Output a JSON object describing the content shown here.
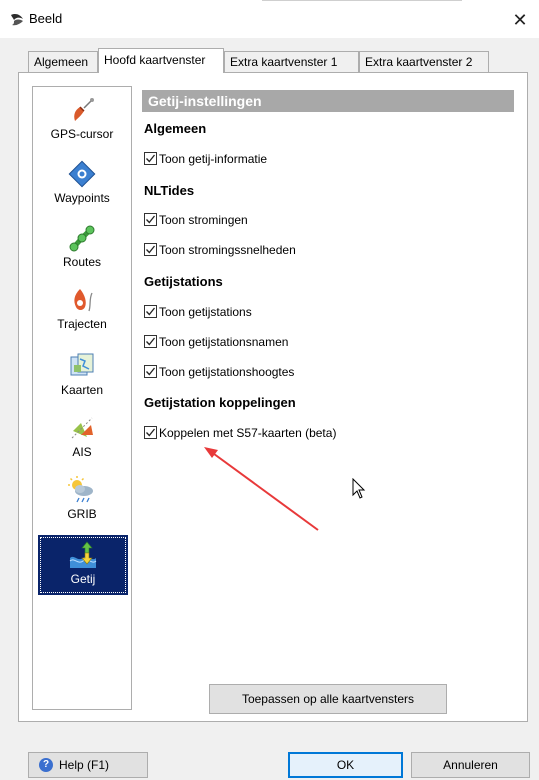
{
  "window": {
    "title": "Beeld",
    "close_symbol": "✕"
  },
  "tabs": [
    {
      "label": "Algemeen"
    },
    {
      "label": "Hoofd kaartvenster"
    },
    {
      "label": "Extra kaartvenster 1"
    },
    {
      "label": "Extra kaartvenster 2"
    }
  ],
  "sidebar": {
    "items": [
      {
        "label": "GPS-cursor",
        "icon": "gps-cursor-icon"
      },
      {
        "label": "Waypoints",
        "icon": "waypoint-icon"
      },
      {
        "label": "Routes",
        "icon": "route-icon"
      },
      {
        "label": "Trajecten",
        "icon": "track-icon"
      },
      {
        "label": "Kaarten",
        "icon": "map-icon"
      },
      {
        "label": "AIS",
        "icon": "ais-icon"
      },
      {
        "label": "GRIB",
        "icon": "grib-weather-icon"
      },
      {
        "label": "Getij",
        "icon": "tide-icon"
      }
    ],
    "selected": "Getij"
  },
  "settings": {
    "header": "Getij-instellingen",
    "groups": [
      {
        "title": "Algemeen",
        "options": [
          {
            "label": "Toon getij-informatie",
            "checked": true
          }
        ]
      },
      {
        "title": "NLTides",
        "options": [
          {
            "label": "Toon stromingen",
            "checked": true
          },
          {
            "label": "Toon stromingssnelheden",
            "checked": true
          }
        ]
      },
      {
        "title": "Getijstations",
        "options": [
          {
            "label": "Toon getijstations",
            "checked": true
          },
          {
            "label": "Toon getijstationsnamen",
            "checked": true
          },
          {
            "label": "Toon getijstationshoogtes",
            "checked": true
          }
        ]
      },
      {
        "title": "Getijstation koppelingen",
        "options": [
          {
            "label": "Koppelen met S57-kaarten (beta)",
            "checked": true
          }
        ]
      }
    ]
  },
  "buttons": {
    "apply_all": "Toepassen op alle kaartvensters",
    "help": "Help (F1)",
    "ok": "OK",
    "cancel": "Annuleren"
  },
  "colors": {
    "accent": "#0078d7",
    "selection": "#0a246a",
    "header_bg": "#a8a8a8",
    "arrow": "#e8393a"
  }
}
